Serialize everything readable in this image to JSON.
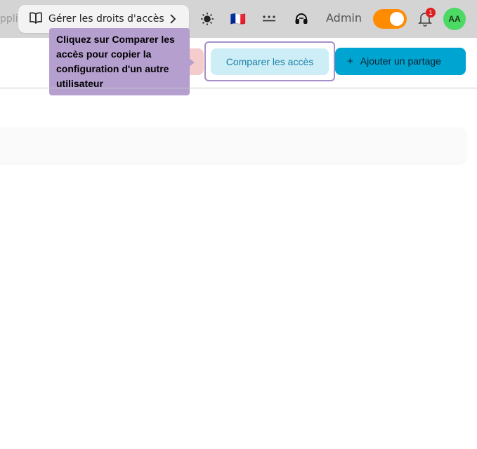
{
  "topbar": {
    "search_stub_text": "pplic",
    "guide": {
      "label": "Gérer les droits d'accès",
      "icon": "book-open-icon",
      "chevron": "chevron-right-icon"
    },
    "theme_icon": "sun-icon",
    "language_flag": "🇫🇷",
    "dots_icon": "more-dots-icon",
    "support_icon": "headset-icon",
    "admin_label": "Admin",
    "toggle_state": "on",
    "notification_count": "1",
    "avatar_initials": "AA"
  },
  "tooltip": {
    "text": "Cliquez sur Comparer les accès pour copier la configuration d'un autre utilisateur"
  },
  "toolbar": {
    "compare_label": "Comparer les accès",
    "add_plus": "+",
    "add_label": "Ajouter un partage"
  },
  "colors": {
    "topbar_bg": "#d4d4d4",
    "toggle": "#ff8c00",
    "avatar": "#4cd964",
    "tooltip": "#b59fcf",
    "primary": "#00a4d1",
    "compare_bg": "#cdeef6"
  }
}
